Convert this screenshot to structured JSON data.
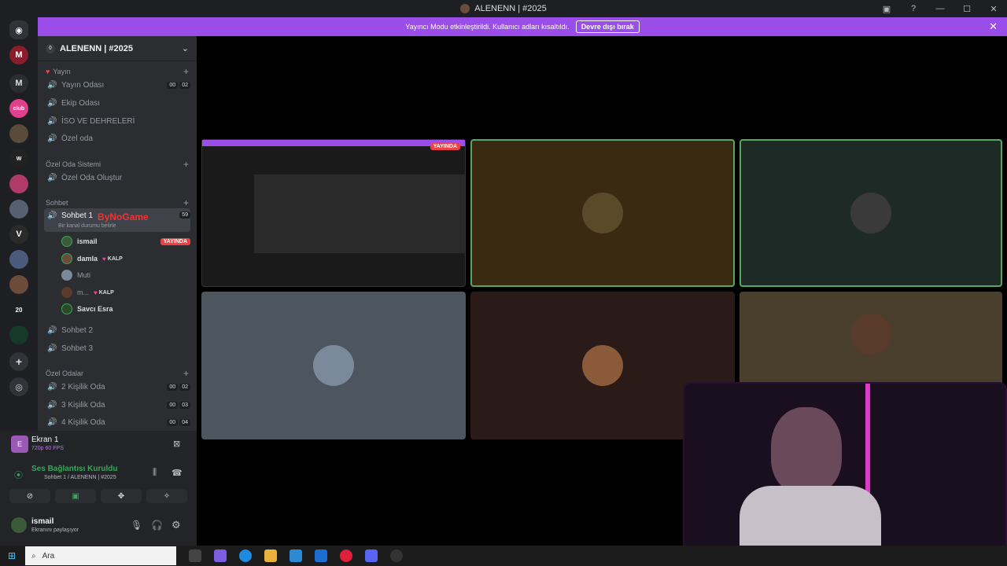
{
  "window": {
    "title": "ALENENN | #2025"
  },
  "banner": {
    "text": "Yayıncı Modu etkinleştirildi. Kullanıcı adları kısaltıldı.",
    "button": "Devre dışı bırak"
  },
  "server": {
    "name": "ALENENN | #2025",
    "boost_count": "0"
  },
  "categories": {
    "yayin": "Yayın",
    "ozel_oda_sistemi": "Özel Oda Sistemi",
    "sohbet": "Sohbet",
    "ozel_odalar": "Özel Odalar"
  },
  "channels": {
    "yayin_odasi": {
      "label": "Yayın Odası",
      "c1": "00",
      "c2": "02"
    },
    "ekip_odasi": {
      "label": "Ekip Odası"
    },
    "iso": {
      "label": "İSO VE DEHRELERİ"
    },
    "ozel_oda": {
      "label": "Özel oda"
    },
    "create": {
      "label": "Özel Oda Oluştur"
    },
    "sohbet1": {
      "label": "Sohbet 1",
      "status": "Bir kanal durumu belirle",
      "count": "59",
      "watermark": "ByNoGame"
    },
    "sohbet2": {
      "label": "Sohbet 2"
    },
    "sohbet3": {
      "label": "Sohbet 3"
    },
    "oda2": {
      "label": "2 Kişilik Oda",
      "c1": "00",
      "c2": "02"
    },
    "oda3": {
      "label": "3 Kişilik Oda",
      "c1": "00",
      "c2": "03"
    },
    "oda4": {
      "label": "4 Kişilik Oda",
      "c1": "00",
      "c2": "04"
    }
  },
  "voice_users": [
    {
      "name": "ismail",
      "badge": "YAYINDA"
    },
    {
      "name": "damla",
      "tag": "KALP"
    },
    {
      "name": "Muti"
    },
    {
      "name": "m...",
      "tag": "KALP"
    },
    {
      "name": "Savcı Esra"
    }
  ],
  "screen_share": {
    "title": "Ekran 1",
    "quality": "720p 60 FPS"
  },
  "voice_status": {
    "title": "Ses Bağlantısı Kuruldu",
    "channel": "Sohbet 1 / ALENENN | #2025"
  },
  "user": {
    "name": "ismail",
    "status": "Ekranını paylaşıyor"
  },
  "stream_badge": "YAYINDA",
  "taskbar": {
    "search_placeholder": "Ara"
  }
}
